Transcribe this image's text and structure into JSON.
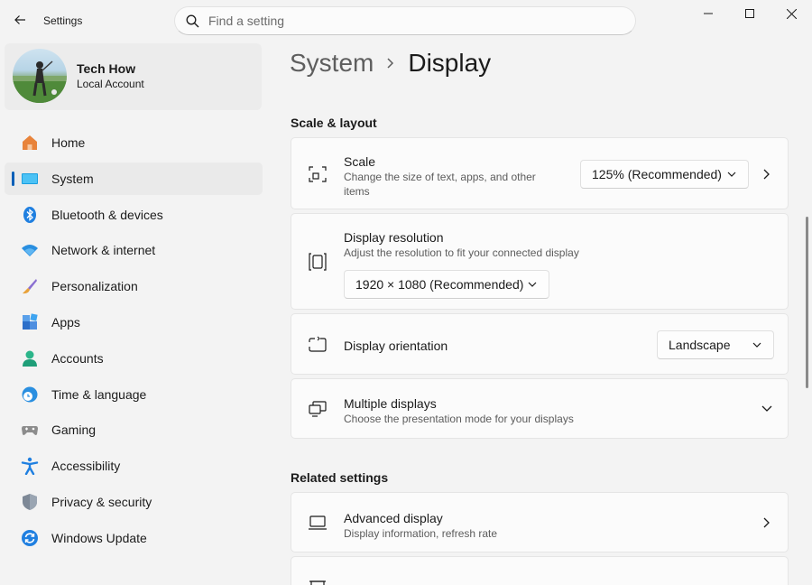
{
  "window": {
    "title": "Settings",
    "search_placeholder": "Find a setting"
  },
  "profile": {
    "name": "Tech How",
    "account_type": "Local Account"
  },
  "sidebar": {
    "items": [
      {
        "label": "Home",
        "icon": "home-icon",
        "active": false
      },
      {
        "label": "System",
        "icon": "system-icon",
        "active": true
      },
      {
        "label": "Bluetooth & devices",
        "icon": "bluetooth-icon",
        "active": false
      },
      {
        "label": "Network & internet",
        "icon": "wifi-icon",
        "active": false
      },
      {
        "label": "Personalization",
        "icon": "brush-icon",
        "active": false
      },
      {
        "label": "Apps",
        "icon": "apps-icon",
        "active": false
      },
      {
        "label": "Accounts",
        "icon": "person-icon",
        "active": false
      },
      {
        "label": "Time & language",
        "icon": "clock-globe-icon",
        "active": false
      },
      {
        "label": "Gaming",
        "icon": "gamepad-icon",
        "active": false
      },
      {
        "label": "Accessibility",
        "icon": "accessibility-icon",
        "active": false
      },
      {
        "label": "Privacy & security",
        "icon": "shield-icon",
        "active": false
      },
      {
        "label": "Windows Update",
        "icon": "update-icon",
        "active": false
      }
    ]
  },
  "breadcrumb": {
    "parent": "System",
    "current": "Display"
  },
  "scale_layout": {
    "title": "Scale & layout",
    "scale": {
      "title": "Scale",
      "description": "Change the size of text, apps, and other items",
      "value": "125% (Recommended)"
    },
    "resolution": {
      "title": "Display resolution",
      "description": "Adjust the resolution to fit your connected display",
      "value": "1920 × 1080 (Recommended)"
    },
    "orientation": {
      "title": "Display orientation",
      "value": "Landscape"
    },
    "multiple": {
      "title": "Multiple displays",
      "description": "Choose the presentation mode for your displays"
    }
  },
  "related": {
    "title": "Related settings",
    "advanced": {
      "title": "Advanced display",
      "description": "Display information, refresh rate"
    }
  },
  "colors": {
    "accent": "#005fb8",
    "background": "#f3f3f3",
    "card": "#fbfbfb"
  }
}
